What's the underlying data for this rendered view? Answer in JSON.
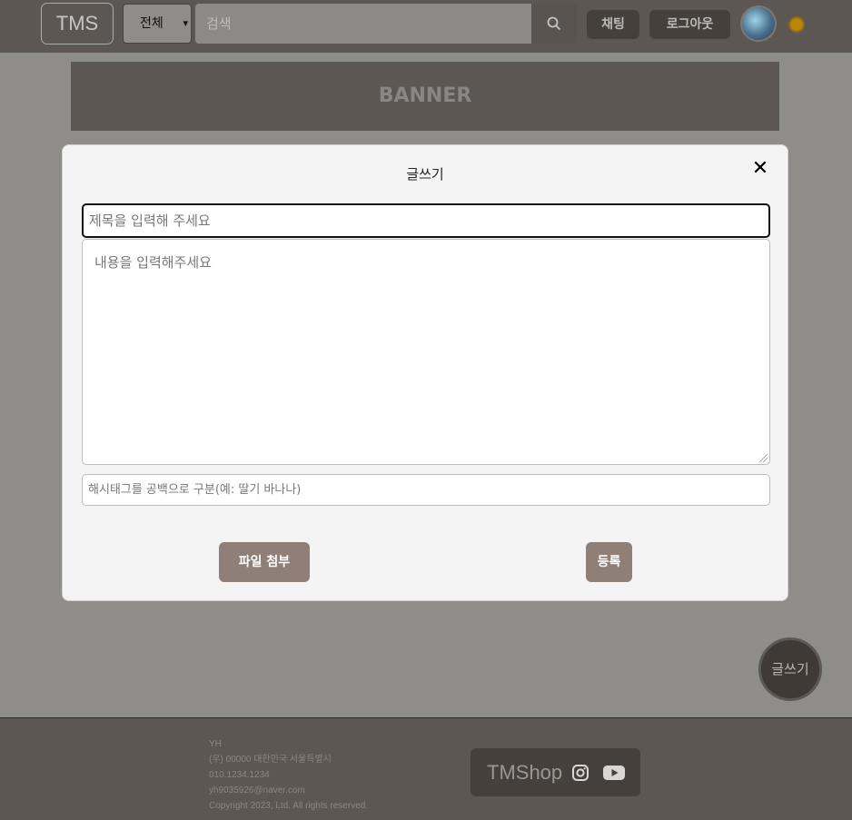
{
  "header": {
    "logo": "TMS",
    "category_select": "전체",
    "search_placeholder": "검색",
    "chat_label": "채팅",
    "logout_label": "로그아웃"
  },
  "banner": {
    "text": "BANNER"
  },
  "modal": {
    "title": "글쓰기",
    "close_label": "✕",
    "title_placeholder": "제목을 입력해 주세요",
    "content_placeholder": "내용을 입력해주세요",
    "hashtag_placeholder": "해시태그를 공백으로 구분(예: 딸기 바나나)",
    "attach_label": "파일 첨부",
    "submit_label": "등록"
  },
  "fab": {
    "label": "글쓰기"
  },
  "footer": {
    "info": [
      "YH",
      "(우) 00000 대한민국 서울특별시",
      "010.1234.1234",
      "yh9035926@naver.com",
      "Copyright 2023, Ltd. All rights reserved."
    ],
    "brand": "TMShop"
  }
}
